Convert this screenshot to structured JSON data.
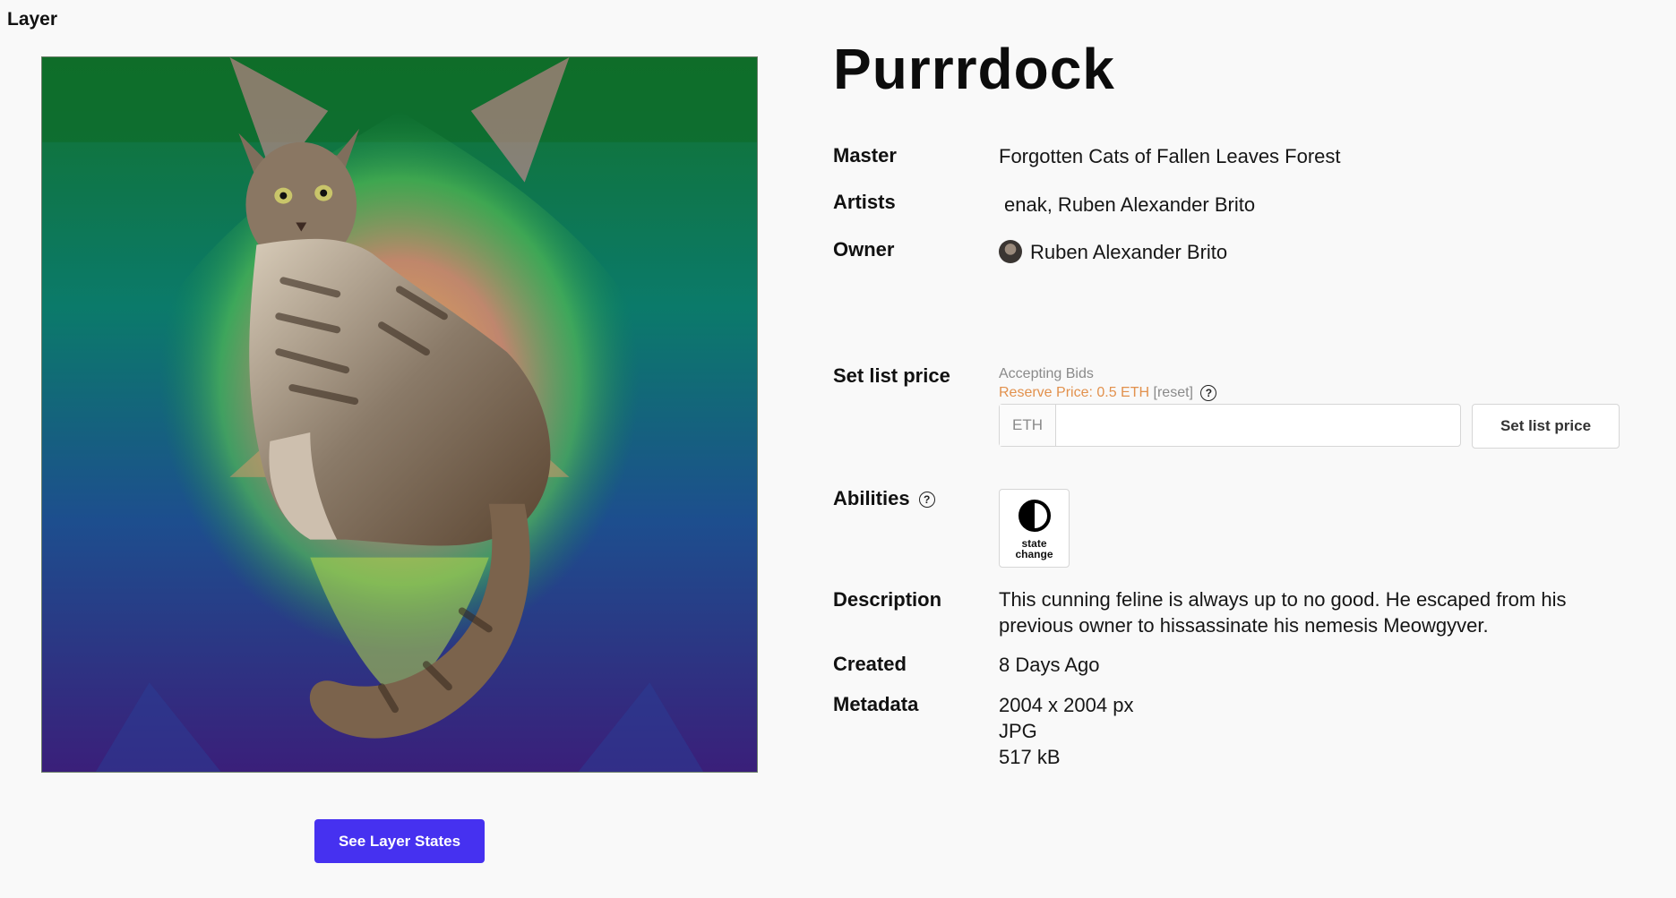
{
  "page": {
    "section_label": "Layer"
  },
  "artwork": {
    "alt": "Purrrdock artwork",
    "cta_label": "See Layer States"
  },
  "details": {
    "title": "Purrrdock",
    "master_label": "Master",
    "master_value": "Forgotten Cats of Fallen Leaves Forest",
    "artists_label": "Artists",
    "artists_value": "enak, Ruben Alexander Brito",
    "owner_label": "Owner",
    "owner_value": "Ruben Alexander Brito",
    "list_price_label": "Set list price",
    "accepting_bids": "Accepting Bids",
    "reserve_price": "Reserve Price: 0.5 ETH",
    "reserve_reset": "[reset]",
    "eth_prefix": "ETH",
    "eth_placeholder": "",
    "set_price_button": "Set list price",
    "abilities_label": "Abilities",
    "ability_name": "state change",
    "description_label": "Description",
    "description_value": "This cunning feline is always up to no good. He escaped from his previous owner to hissassinate his nemesis Meowgyver.",
    "created_label": "Created",
    "created_value": "8 Days Ago",
    "metadata_label": "Metadata",
    "metadata_dimensions": "2004 x 2004 px",
    "metadata_format": "JPG",
    "metadata_size": "517 kB"
  },
  "icons": {
    "help": "help-circle-icon",
    "state_change": "half-circle-icon",
    "avatar": "owner-avatar"
  }
}
